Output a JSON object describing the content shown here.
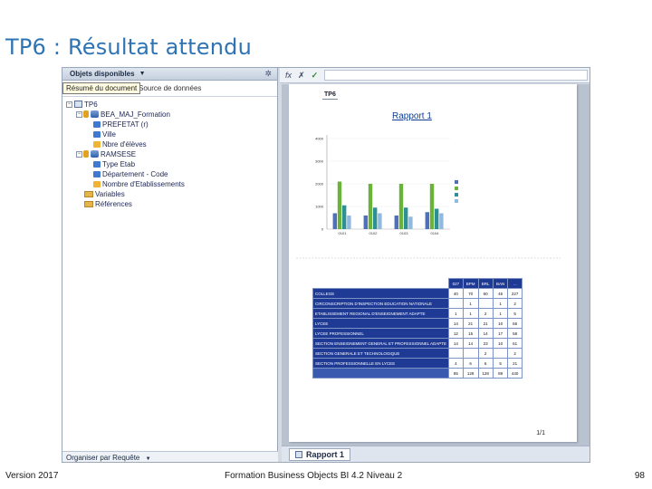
{
  "slide": {
    "title": "TP6 : Résultat attendu",
    "footer_left": "Version 2017",
    "footer_center": "Formation Business Objects BI 4.2 Niveau 2",
    "footer_right": "98"
  },
  "left_panel": {
    "header": "Objets disponibles",
    "tooltip": "Résumé du document",
    "tab_behind": "Source de données",
    "bottom": "Organiser par Requête",
    "tree": [
      {
        "label": "TP6",
        "icon": "report-icon",
        "toggle": "−"
      },
      {
        "label": "BEA_MAJ_Formation",
        "icon": "database-icon",
        "toggle": "−"
      },
      {
        "label": "PREFETAT (r)",
        "icon": "dimension-icon"
      },
      {
        "label": "Ville",
        "icon": "dimension-icon"
      },
      {
        "label": "Nbre d'élèves",
        "icon": "measure-icon"
      },
      {
        "label": "RAMSESE",
        "icon": "database-icon",
        "toggle": "−"
      },
      {
        "label": "Type Etab",
        "icon": "dimension-icon"
      },
      {
        "label": "Département - Code",
        "icon": "dimension-icon"
      },
      {
        "label": "Nombre d'Etablissements",
        "icon": "measure-icon"
      },
      {
        "label": "Variables",
        "icon": "folder-icon"
      },
      {
        "label": "Références",
        "icon": "folder-icon"
      }
    ]
  },
  "toolbar": {
    "fx": "fx",
    "cancel": "✗",
    "ok": "✓"
  },
  "report": {
    "page_tab": "TP6",
    "title": "Rapport 1",
    "page_number": "1/1",
    "tab_label": "Rapport 1"
  },
  "chart_data": {
    "type": "bar",
    "ylim": [
      0,
      3000
    ],
    "yticks": [
      "0",
      "1000",
      "2000",
      "3000",
      "4000"
    ],
    "categories": [
      "0101",
      "0102",
      "0103",
      "0104"
    ],
    "series": [
      {
        "values": [
          700,
          600,
          600,
          750
        ],
        "color": "#4f6fb7"
      },
      {
        "values": [
          2100,
          2000,
          2000,
          2000
        ],
        "color": "#6ab23a"
      },
      {
        "values": [
          1050,
          950,
          950,
          900
        ],
        "color": "#2f8f97"
      },
      {
        "values": [
          600,
          700,
          550,
          700
        ],
        "color": "#91b8de"
      }
    ]
  },
  "table": {
    "header": [
      "027",
      "BPM",
      "BRL",
      "BAN",
      "…"
    ],
    "rows": [
      {
        "label": "COLLEGE",
        "values": [
          "40",
          "70",
          "60",
          "45",
          "227"
        ]
      },
      {
        "label": "CIRCONSCRIPTION D'INSPECTION EDUCATION NATIONALE",
        "values": [
          "",
          "1",
          "",
          "1",
          "2"
        ]
      },
      {
        "label": "ETABLISSEMENT REGIONAL D'ENSEIGNEMENT ADAPTE",
        "values": [
          "1",
          "1",
          "2",
          "1",
          "5"
        ]
      },
      {
        "label": "LYCEE",
        "values": [
          "14",
          "21",
          "21",
          "10",
          "66"
        ]
      },
      {
        "label": "LYCEE PROFESSIONNEL",
        "values": [
          "12",
          "15",
          "14",
          "17",
          "58"
        ]
      },
      {
        "label": "SECTION ENSEIGNEMENT GENERAL ET PROFESSIONNEL ADAPTE",
        "values": [
          "14",
          "14",
          "23",
          "10",
          "61"
        ]
      },
      {
        "label": "SECTION GENERALE ET TECHNOLOGIQUE",
        "values": [
          "",
          "",
          "2",
          "",
          "2"
        ]
      },
      {
        "label": "SECTION PROFESSIONNELLE EN LYCEE",
        "values": [
          "4",
          "6",
          "6",
          "5",
          "21"
        ]
      },
      {
        "label": "",
        "values": [
          "85",
          "128",
          "128",
          "89",
          "440"
        ],
        "total": true
      }
    ]
  }
}
